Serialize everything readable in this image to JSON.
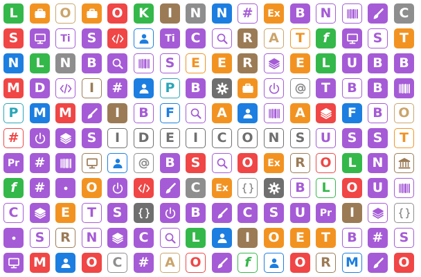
{
  "palette": {
    "green": "#34b84a",
    "orange": "#f29321",
    "tan": "#cba46a",
    "red": "#f04646",
    "brown": "#9b7b55",
    "blue": "#1c7ee0",
    "purple": "#a55bd6",
    "violet": "#9b5ae8",
    "gray": "#8e8e8e",
    "dgray": "#6f6f6f",
    "teal": "#2aa6b8"
  },
  "grid": {
    "rows": [
      [
        [
          "L",
          "green",
          "f"
        ],
        [
          "briefcase-icon",
          "orange",
          "f"
        ],
        [
          "O",
          "tan",
          "o"
        ],
        [
          "briefcase-icon",
          "orange",
          "f"
        ],
        [
          "O",
          "red",
          "f"
        ],
        [
          "K",
          "green",
          "f"
        ],
        [
          "I",
          "brown",
          "f"
        ],
        [
          "N",
          "gray",
          "f"
        ],
        [
          "N",
          "blue",
          "f"
        ],
        [
          "#",
          "purple",
          "o"
        ],
        [
          "Ex",
          "orange",
          "f"
        ],
        [
          "B",
          "purple",
          "f"
        ],
        [
          "N",
          "purple",
          "o"
        ],
        [
          "barcode-icon",
          "purple",
          "o"
        ],
        [
          "brush-icon",
          "purple",
          "f"
        ],
        [
          "C",
          "gray",
          "f"
        ]
      ],
      [
        [
          "S",
          "red",
          "f"
        ],
        [
          "monitor-icon",
          "purple",
          "f"
        ],
        [
          "Ti",
          "purple",
          "o"
        ],
        [
          "S",
          "purple",
          "f"
        ],
        [
          "code-icon",
          "red",
          "f"
        ],
        [
          "person-icon",
          "blue",
          "o"
        ],
        [
          "Ti",
          "purple",
          "f"
        ],
        [
          "C",
          "purple",
          "f"
        ],
        [
          "search-icon",
          "purple",
          "o"
        ],
        [
          "R",
          "brown",
          "f"
        ],
        [
          "A",
          "tan",
          "o"
        ],
        [
          "T",
          "orange",
          "o"
        ],
        [
          "f",
          "green",
          "f"
        ],
        [
          "monitor-icon",
          "purple",
          "f"
        ],
        [
          "S",
          "purple",
          "o"
        ],
        [
          "T",
          "orange",
          "f"
        ]
      ],
      [
        [
          "N",
          "blue",
          "f"
        ],
        [
          "L",
          "green",
          "f"
        ],
        [
          "N",
          "gray",
          "f"
        ],
        [
          "B",
          "purple",
          "f"
        ],
        [
          "search-icon",
          "purple",
          "f"
        ],
        [
          "barcode-icon",
          "purple",
          "o"
        ],
        [
          "S",
          "purple",
          "o"
        ],
        [
          "E",
          "orange",
          "o"
        ],
        [
          "E",
          "orange",
          "f"
        ],
        [
          "R",
          "brown",
          "f"
        ],
        [
          "layers-icon",
          "purple",
          "o"
        ],
        [
          "E",
          "orange",
          "f"
        ],
        [
          "L",
          "green",
          "f"
        ],
        [
          "U",
          "purple",
          "f"
        ],
        [
          "B",
          "purple",
          "f"
        ],
        [
          "B",
          "purple",
          "f"
        ]
      ],
      [
        [
          "M",
          "red",
          "f"
        ],
        [
          "D",
          "purple",
          "f"
        ],
        [
          "code-icon",
          "purple",
          "o"
        ],
        [
          "I",
          "brown",
          "o"
        ],
        [
          "#",
          "purple",
          "f"
        ],
        [
          "person-icon",
          "blue",
          "f"
        ],
        [
          "P",
          "teal",
          "o"
        ],
        [
          "B",
          "purple",
          "f"
        ],
        [
          "gear-icon",
          "dgray",
          "f"
        ],
        [
          "briefcase-icon",
          "orange",
          "f"
        ],
        [
          "power-icon",
          "purple",
          "o"
        ],
        [
          "at-icon",
          "gray",
          "o"
        ],
        [
          "T",
          "purple",
          "f"
        ],
        [
          "B",
          "purple",
          "o"
        ],
        [
          "B",
          "purple",
          "f"
        ],
        [
          "barcode-icon",
          "purple",
          "f"
        ]
      ],
      [
        [
          "P",
          "teal",
          "o"
        ],
        [
          "M",
          "blue",
          "f"
        ],
        [
          "M",
          "red",
          "f"
        ],
        [
          "brush-icon",
          "purple",
          "f"
        ],
        [
          "I",
          "brown",
          "f"
        ],
        [
          "B",
          "purple",
          "o"
        ],
        [
          "F",
          "blue",
          "o"
        ],
        [
          "search-icon",
          "purple",
          "o"
        ],
        [
          "A",
          "orange",
          "f"
        ],
        [
          "person-icon",
          "blue",
          "f"
        ],
        [
          "barcode-icon",
          "purple",
          "o"
        ],
        [
          "A",
          "orange",
          "f"
        ],
        [
          "layers-icon",
          "red",
          "f"
        ],
        [
          "F",
          "blue",
          "f"
        ],
        [
          "B",
          "purple",
          "o"
        ],
        [
          "O",
          "tan",
          "o"
        ]
      ],
      [
        [
          "#",
          "red",
          "o"
        ],
        [
          "power-icon",
          "purple",
          "f"
        ],
        [
          "layers-icon",
          "purple",
          "f"
        ],
        [
          "S",
          "purple",
          "f"
        ],
        [
          "I",
          "dgray",
          "o"
        ],
        [
          "D",
          "dgray",
          "o"
        ],
        [
          "E",
          "dgray",
          "o"
        ],
        [
          "I",
          "dgray",
          "o"
        ],
        [
          "C",
          "dgray",
          "o"
        ],
        [
          "O",
          "dgray",
          "o"
        ],
        [
          "N",
          "dgray",
          "o"
        ],
        [
          "S",
          "dgray",
          "o"
        ],
        [
          "U",
          "purple",
          "o"
        ],
        [
          "S",
          "purple",
          "f"
        ],
        [
          "S",
          "purple",
          "f"
        ],
        [
          "T",
          "orange",
          "o"
        ]
      ],
      [
        [
          "Pr",
          "purple",
          "f"
        ],
        [
          "#",
          "purple",
          "f"
        ],
        [
          "barcode-icon",
          "purple",
          "f"
        ],
        [
          "monitor-icon",
          "brown",
          "o"
        ],
        [
          "person-icon",
          "blue",
          "o"
        ],
        [
          "at-icon",
          "gray",
          "o"
        ],
        [
          "B",
          "purple",
          "f"
        ],
        [
          "S",
          "red",
          "f"
        ],
        [
          "search-icon",
          "purple",
          "o"
        ],
        [
          "O",
          "red",
          "f"
        ],
        [
          "Ex",
          "orange",
          "f"
        ],
        [
          "R",
          "brown",
          "o"
        ],
        [
          "O",
          "red",
          "o"
        ],
        [
          "L",
          "green",
          "f"
        ],
        [
          "N",
          "purple",
          "f"
        ],
        [
          "bank-icon",
          "brown",
          "o"
        ]
      ],
      [
        [
          "f",
          "green",
          "f"
        ],
        [
          "#",
          "purple",
          "f"
        ],
        [
          "dot-icon",
          "purple",
          "f"
        ],
        [
          "O",
          "orange",
          "f"
        ],
        [
          "power-icon",
          "purple",
          "f"
        ],
        [
          "code-icon",
          "red",
          "f"
        ],
        [
          "brush-icon",
          "purple",
          "f"
        ],
        [
          "C",
          "gray",
          "f"
        ],
        [
          "Ex",
          "orange",
          "f"
        ],
        [
          "braces-icon",
          "gray",
          "o"
        ],
        [
          "gear-icon",
          "dgray",
          "f"
        ],
        [
          "B",
          "purple",
          "o"
        ],
        [
          "L",
          "green",
          "o"
        ],
        [
          "O",
          "red",
          "f"
        ],
        [
          "U",
          "purple",
          "f"
        ],
        [
          "barcode-icon",
          "purple",
          "o"
        ]
      ],
      [
        [
          "C",
          "purple",
          "o"
        ],
        [
          "layers-icon",
          "purple",
          "f"
        ],
        [
          "E",
          "orange",
          "f"
        ],
        [
          "T",
          "purple",
          "o"
        ],
        [
          "S",
          "purple",
          "f"
        ],
        [
          "braces-icon",
          "dgray",
          "f"
        ],
        [
          "power-icon",
          "purple",
          "f"
        ],
        [
          "B",
          "purple",
          "f"
        ],
        [
          "brush-icon",
          "purple",
          "f"
        ],
        [
          "C",
          "purple",
          "f"
        ],
        [
          "S",
          "purple",
          "f"
        ],
        [
          "U",
          "purple",
          "f"
        ],
        [
          "Pr",
          "purple",
          "f"
        ],
        [
          "I",
          "brown",
          "f"
        ],
        [
          "layers-icon",
          "purple",
          "o"
        ],
        [
          "braces-icon",
          "gray",
          "o"
        ]
      ],
      [
        [
          "dot-icon",
          "purple",
          "f"
        ],
        [
          "S",
          "purple",
          "o"
        ],
        [
          "R",
          "brown",
          "o"
        ],
        [
          "N",
          "purple",
          "o"
        ],
        [
          "layers-icon",
          "purple",
          "f"
        ],
        [
          "C",
          "purple",
          "f"
        ],
        [
          "search-icon",
          "purple",
          "o"
        ],
        [
          "L",
          "green",
          "f"
        ],
        [
          "person-icon",
          "blue",
          "f"
        ],
        [
          "I",
          "brown",
          "f"
        ],
        [
          "O",
          "orange",
          "f"
        ],
        [
          "E",
          "orange",
          "f"
        ],
        [
          "T",
          "orange",
          "f"
        ],
        [
          "B",
          "purple",
          "o"
        ],
        [
          "#",
          "purple",
          "f"
        ],
        [
          "S",
          "purple",
          "o"
        ]
      ],
      [
        [
          "monitor-icon",
          "purple",
          "f"
        ],
        [
          "M",
          "red",
          "f"
        ],
        [
          "person-icon",
          "blue",
          "f"
        ],
        [
          "O",
          "red",
          "f"
        ],
        [
          "C",
          "gray",
          "o"
        ],
        [
          "#",
          "purple",
          "f"
        ],
        [
          "A",
          "tan",
          "o"
        ],
        [
          "O",
          "red",
          "o"
        ],
        [
          "brush-icon",
          "purple",
          "f"
        ],
        [
          "f",
          "green",
          "o"
        ],
        [
          "person-icon",
          "blue",
          "o"
        ],
        [
          "O",
          "red",
          "f"
        ],
        [
          "R",
          "brown",
          "o"
        ],
        [
          "M",
          "blue",
          "o"
        ],
        [
          "brush-icon",
          "purple",
          "f"
        ],
        [
          "O",
          "red",
          "f"
        ]
      ]
    ]
  }
}
